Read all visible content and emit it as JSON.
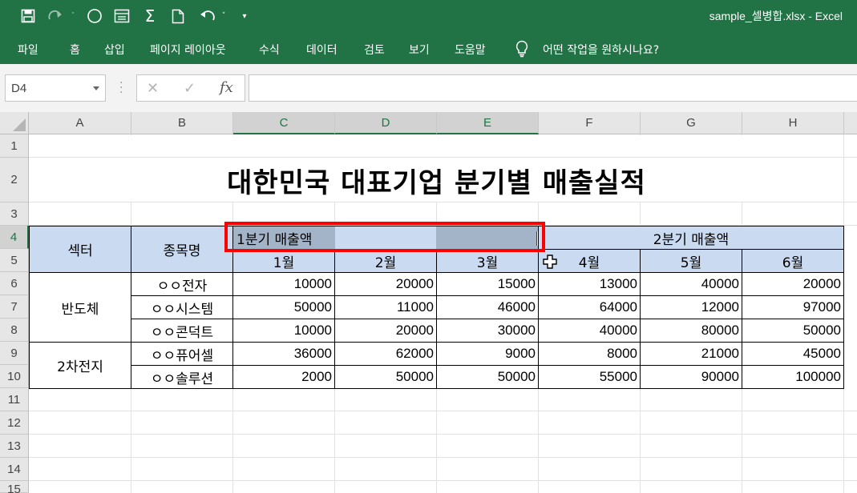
{
  "titlebar": {
    "window_title": "sample_셀병합.xlsx  -  Excel",
    "icons": [
      "save-icon",
      "redo-icon",
      "circle-icon",
      "form-icon",
      "autosum-icon",
      "new-file-icon",
      "undo-icon",
      "customize-icon"
    ]
  },
  "ribbon": {
    "tabs": [
      "파일",
      "홈",
      "삽입",
      "페이지 레이아웃",
      "수식",
      "데이터",
      "검토",
      "보기",
      "도움말"
    ],
    "tell_me": "어떤 작업을 원하시나요?"
  },
  "formula_bar": {
    "name_box": "D4",
    "fx": "fx",
    "cancel": "✕",
    "enter": "✓",
    "formula": ""
  },
  "grid": {
    "columns": [
      "A",
      "B",
      "C",
      "D",
      "E",
      "F",
      "G",
      "H"
    ],
    "rows": [
      "1",
      "2",
      "3",
      "4",
      "5",
      "6",
      "7",
      "8",
      "9",
      "10",
      "11",
      "12",
      "13",
      "14",
      "15"
    ],
    "selected_columns": [
      "C",
      "D",
      "E"
    ],
    "selected_row": "4"
  },
  "sheet": {
    "title": "대한민국 대표기업 분기별 매출실적",
    "header_sector": "섹터",
    "header_stock": "종목명",
    "q1": "1분기 매출액",
    "q2": "2분기 매출액",
    "months": [
      "1월",
      "2월",
      "3월",
      "4월",
      "5월",
      "6월"
    ],
    "groups": [
      {
        "sector": "반도체",
        "rows": [
          {
            "name": "ㅇㅇ전자",
            "values": [
              "10000",
              "20000",
              "15000",
              "13000",
              "40000",
              "20000"
            ]
          },
          {
            "name": "ㅇㅇ시스템",
            "values": [
              "50000",
              "11000",
              "46000",
              "64000",
              "12000",
              "97000"
            ]
          },
          {
            "name": "ㅇㅇ콘덕트",
            "values": [
              "10000",
              "20000",
              "30000",
              "40000",
              "80000",
              "50000"
            ]
          }
        ]
      },
      {
        "sector": "2차전지",
        "rows": [
          {
            "name": "ㅇㅇ퓨어셀",
            "values": [
              "36000",
              "62000",
              "9000",
              "8000",
              "21000",
              "45000"
            ]
          },
          {
            "name": "ㅇㅇ솔루션",
            "values": [
              "2000",
              "50000",
              "50000",
              "55000",
              "90000",
              "100000"
            ]
          }
        ]
      }
    ]
  },
  "colors": {
    "excel_green": "#217346",
    "header_fill": "#c9daf1",
    "selection_fill": "#a3b3c8",
    "highlight_red": "#ff0000"
  }
}
